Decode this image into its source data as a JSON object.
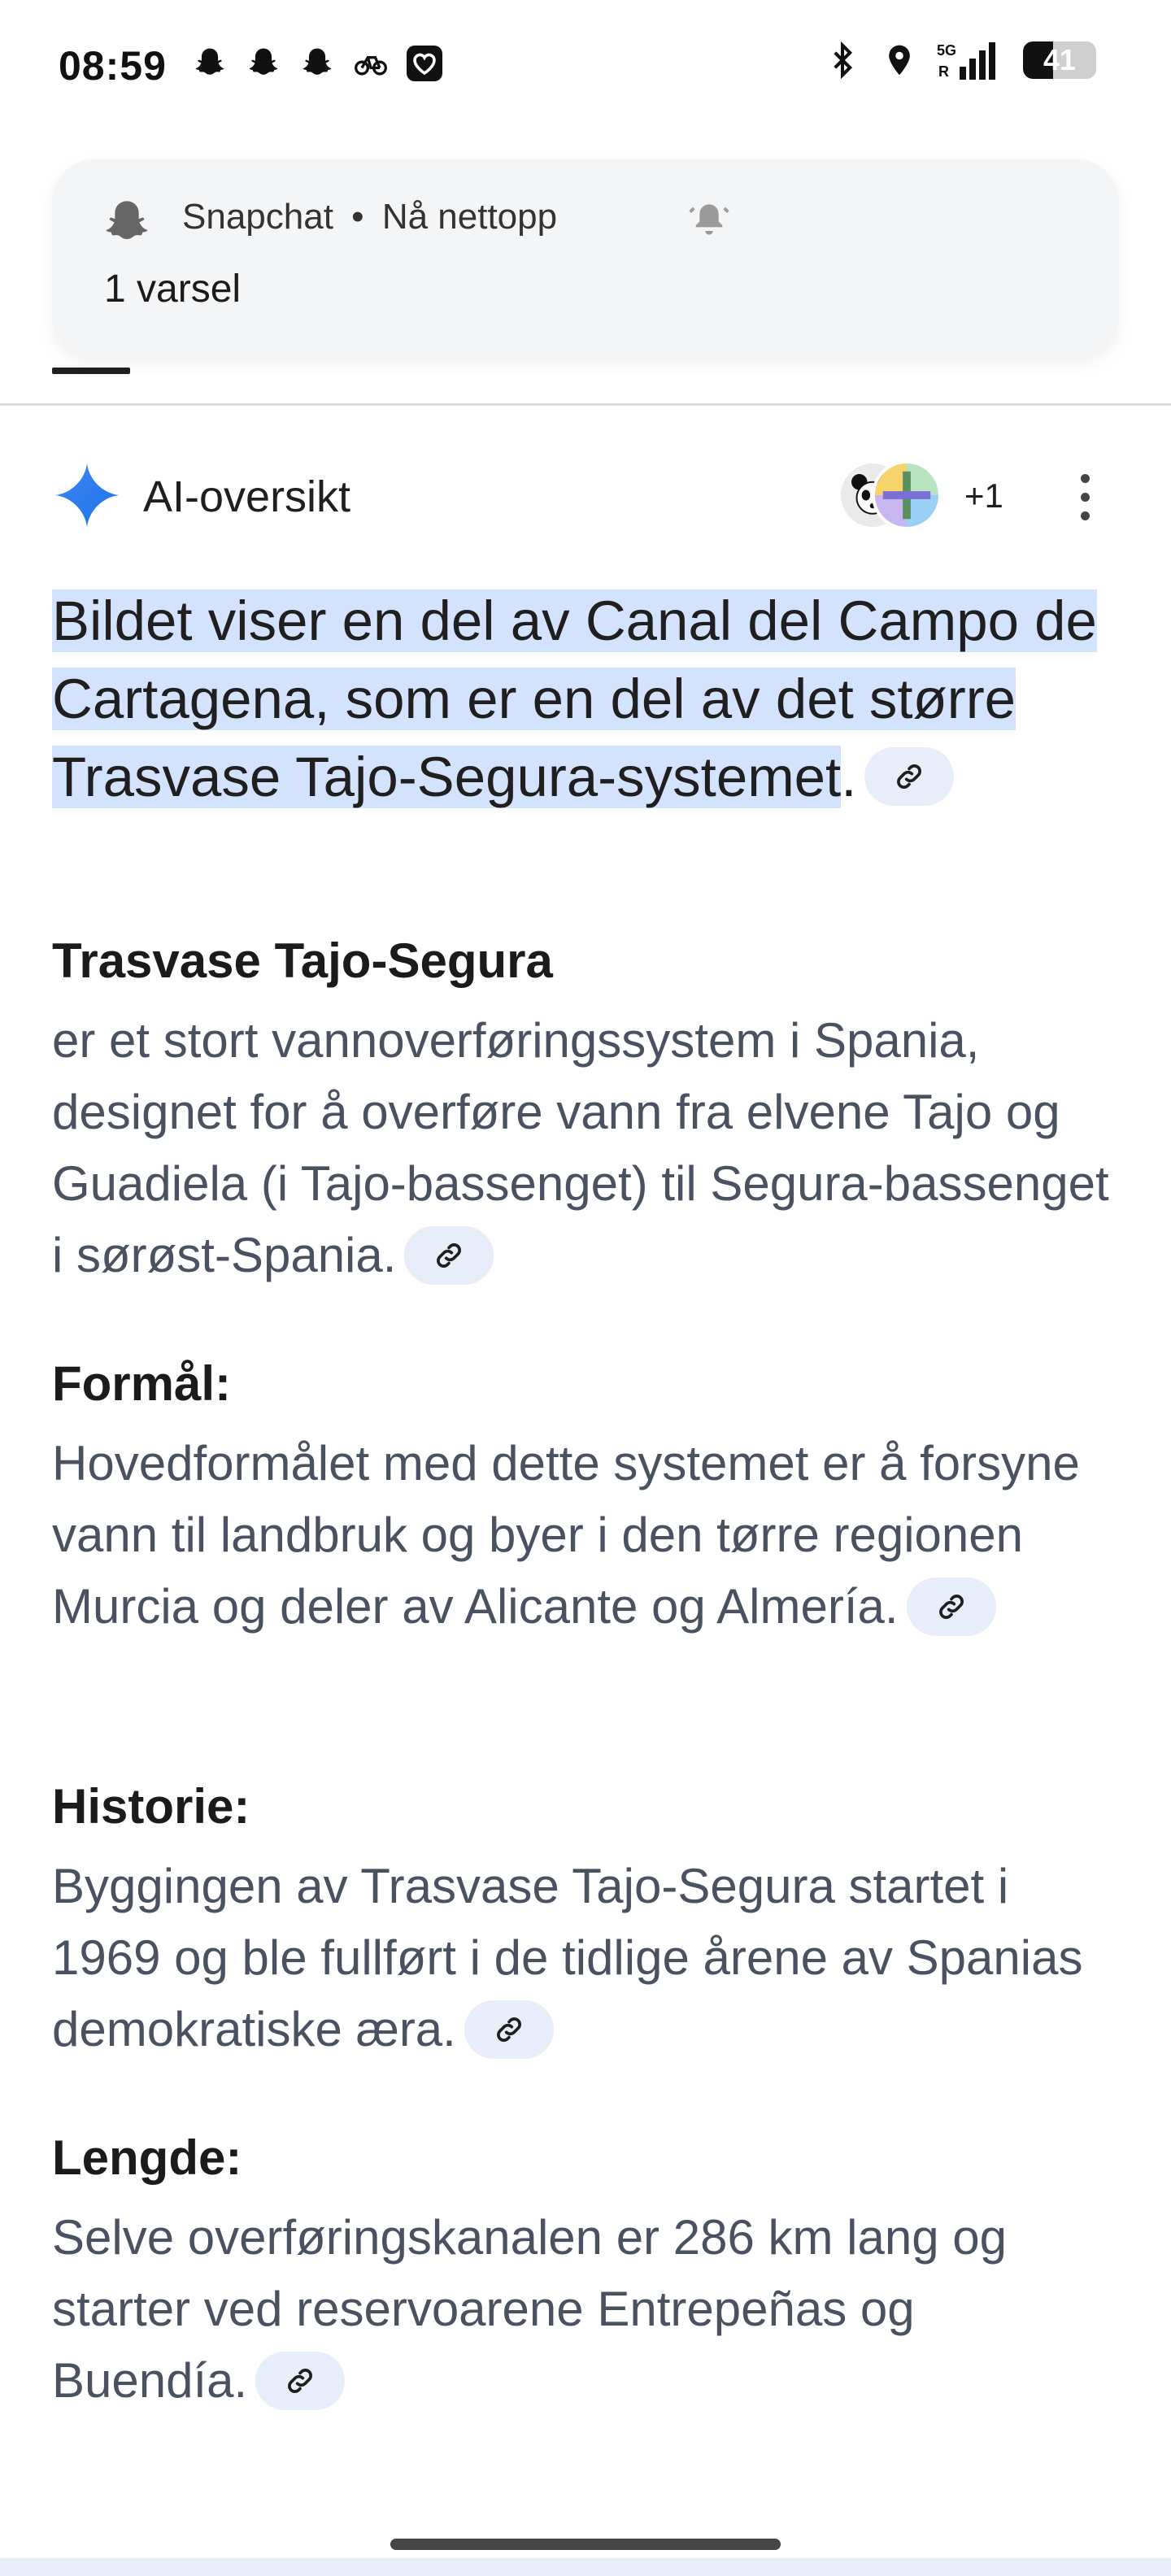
{
  "status_bar": {
    "time": "08:59",
    "battery_level": "41",
    "battery_fraction": 0.41,
    "icons_left": [
      "snapchat-icon",
      "snapchat-icon",
      "snapchat-icon",
      "bike-icon",
      "heart-app-icon"
    ],
    "icons_right": [
      "bluetooth-icon",
      "location-icon",
      "signal-5g-icon",
      "battery-icon"
    ],
    "network_label": "5G",
    "roaming_label": "R"
  },
  "notification": {
    "app": "Snapchat",
    "separator": "•",
    "time": "Nå nettopp",
    "text": "1 varsel"
  },
  "ai_overview": {
    "title": "AI-oversikt",
    "sources_more": "+1"
  },
  "summary": {
    "highlight": "Bildet viser en del av Canal del Campo de Cartagena, som er en del av det større Trasvase Tajo-Segura-systemet",
    "end": "."
  },
  "sections": [
    {
      "title": "Trasvase Tajo-Segura",
      "body": "er et stort vannoverføringssystem i Spania, designet for å overføre vann fra elvene Tajo og Guadiela (i Tajo-bassenget) til Segura-bassenget i sørøst-Spania."
    },
    {
      "title": "Formål:",
      "body": "Hovedformålet med dette systemet er å forsyne vann til landbruk og byer i den tørre regionen Murcia og deler av Alicante og Almería."
    },
    {
      "title": "Historie:",
      "body": "Byggingen av Trasvase Tajo-Segura startet i 1969 og ble fullført i de tidlige årene av Spanias demokratiske æra."
    },
    {
      "title": "Lengde:",
      "body": "Selve overføringskanalen er 286 km lang og starter ved reservoarene Entrepeñas og Buendía."
    }
  ],
  "colors": {
    "highlight": "#d3e3fd",
    "chip": "#e8eef9",
    "sparkle": "#4285f4",
    "body_text": "#4a5160"
  }
}
